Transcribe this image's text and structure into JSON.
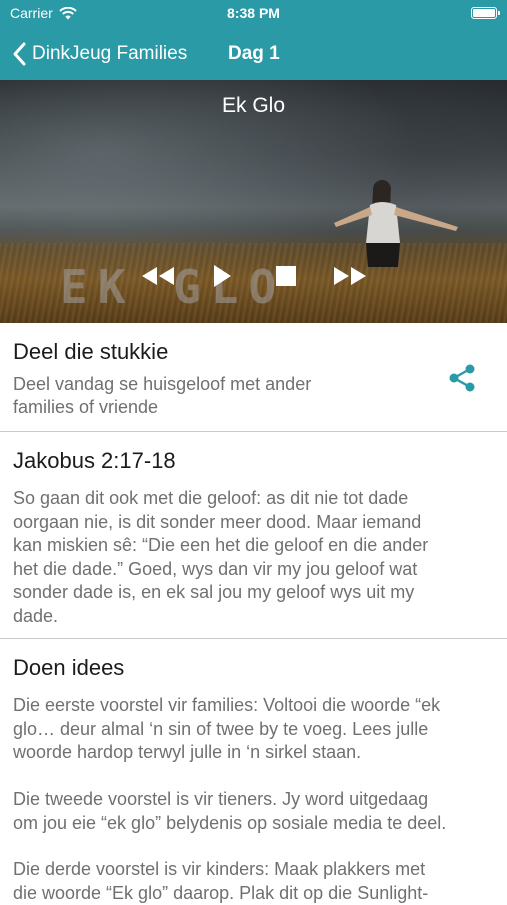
{
  "status": {
    "carrier": "Carrier",
    "time": "8:38 PM",
    "battery_level": 1.0
  },
  "nav": {
    "back_label": "DinkJeug Families",
    "title": "Dag 1"
  },
  "hero": {
    "title": "Ek Glo",
    "watermark": "EK GLO"
  },
  "controls": [
    "rewind-icon",
    "play-icon",
    "stop-icon",
    "fast-forward-icon"
  ],
  "share_section": {
    "heading": "Deel die stukkie",
    "line1": "Deel vandag se huisgeloof met ander",
    "line2": "families of vriende",
    "icon": "share-icon",
    "accent": "#2a9aa6"
  },
  "scripture": {
    "heading": "Jakobus 2:17-18",
    "lines": [
      "So gaan dit ook met die geloof: as dit nie tot dade",
      "oorgaan nie, is dit sonder meer dood. Maar iemand",
      "kan miskien sê: “Die een het die geloof en die ander",
      "het die dade.” Goed, wys dan vir my jou geloof wat",
      "sonder dade is, en ek sal jou my geloof wys uit my",
      "dade."
    ]
  },
  "ideas": {
    "heading": "Doen idees",
    "p1": [
      "Die eerste voorstel vir families: Voltooi die woorde “ek",
      "glo… deur almal ‘n sin of twee by te voeg. Lees julle",
      "woorde hardop terwyl julle in ‘n sirkel staan."
    ],
    "p2": [
      "Die tweede voorstel is vir tieners. Jy word uitgedaag",
      "om jou eie “ek glo” belydenis op sosiale media te deel."
    ],
    "p3": [
      "Die derde voorstel is vir kinders: Maak plakkers met",
      "die woorde “Ek glo” daarop. Plak dit op die Sunlight-"
    ]
  },
  "colors": {
    "bar": "#2a9aa6",
    "heading": "#1b1b1b",
    "body": "#707070",
    "divider": "#c9c9c9"
  }
}
